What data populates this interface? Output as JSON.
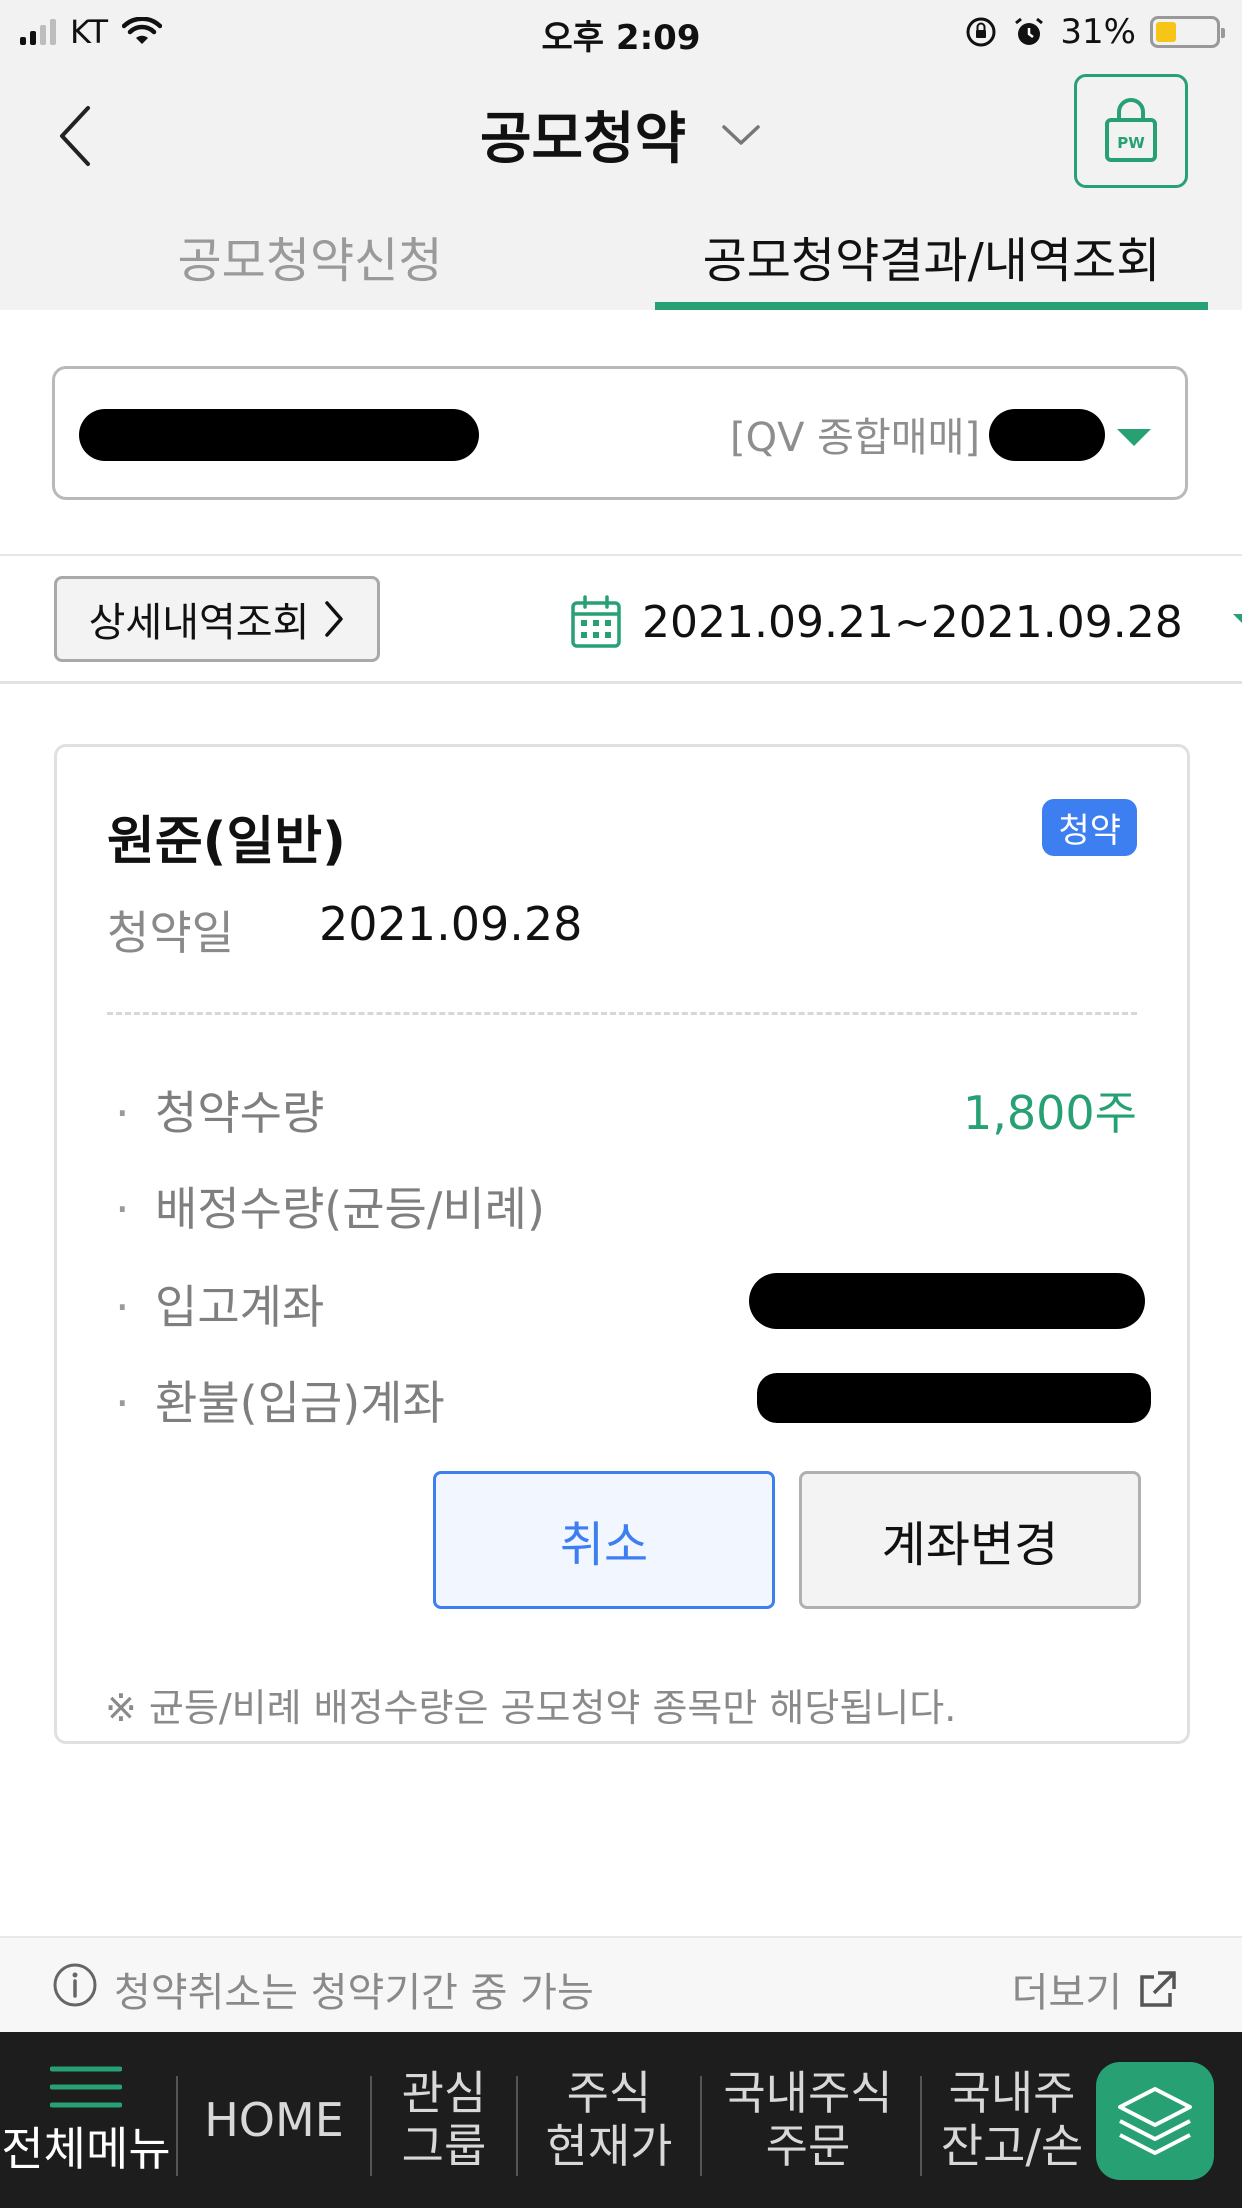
{
  "status_bar": {
    "carrier": "KT",
    "time": "오후 2:09",
    "battery": "31%",
    "battery_level": 0.31
  },
  "header": {
    "title": "공모청약",
    "pw_label": "PW"
  },
  "tabs": [
    {
      "label": "공모청약신청",
      "active": false
    },
    {
      "label": "공모청약결과/내역조회",
      "active": true
    }
  ],
  "account": {
    "type_label": "[QV 종합매매]"
  },
  "filter": {
    "detail_button": "상세내역조회",
    "date_range": "2021.09.21~2021.09.28"
  },
  "card": {
    "title": "원준(일반)",
    "badge": "청약",
    "date_label": "청약일",
    "date_value": "2021.09.28",
    "rows": [
      {
        "label": "청약수량",
        "value": "1,800주"
      },
      {
        "label": "배정수량(균등/비례)",
        "value": ""
      },
      {
        "label": "입고계좌",
        "value": ""
      },
      {
        "label": "환불(입금)계좌",
        "value": ""
      }
    ],
    "cancel_button": "취소",
    "change_button": "계좌변경",
    "note": "※ 균등/비례 배정수량은 공모청약 종목만 해당됩니다."
  },
  "info_bar": {
    "text": "청약취소는 청약기간 중 가능",
    "more": "더보기"
  },
  "bottom_nav": {
    "items": [
      {
        "label": "전체메뉴"
      },
      {
        "label": "HOME"
      },
      {
        "label_line1": "관심",
        "label_line2": "그룹"
      },
      {
        "label_line1": "주식",
        "label_line2": "현재가"
      },
      {
        "label_line1": "국내주식",
        "label_line2": "주문"
      },
      {
        "label_line1": "국내주",
        "label_line2": "잔고/손"
      }
    ]
  },
  "colors": {
    "accent_green": "#27a173",
    "accent_blue": "#3d7ff0"
  }
}
